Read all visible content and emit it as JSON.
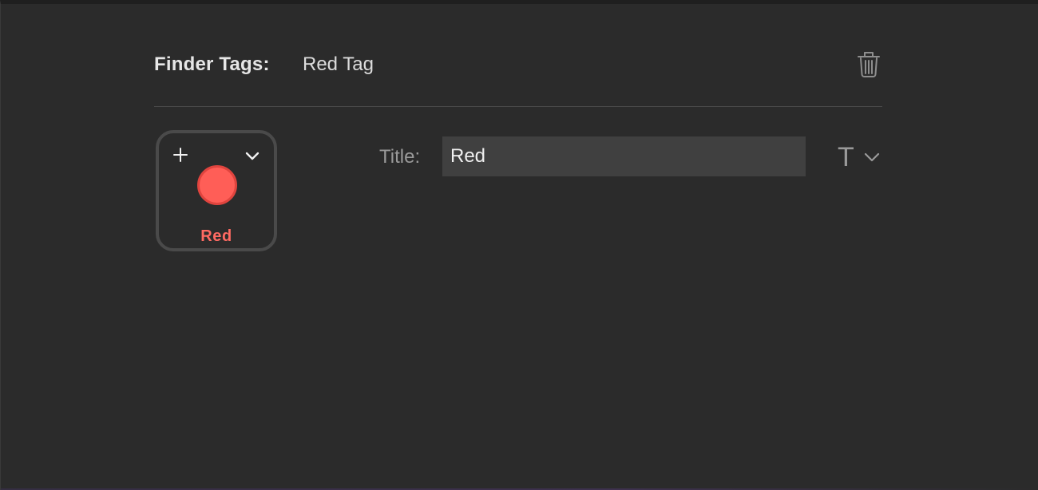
{
  "header": {
    "label": "Finder Tags:",
    "value": "Red Tag",
    "delete_icon": "trash-icon"
  },
  "tag_tile": {
    "caption": "Red",
    "color": "#ff5e57",
    "caption_color": "#ff6a62",
    "add_icon": "plus-icon",
    "menu_icon": "chevron-down-icon"
  },
  "form": {
    "title_label": "Title:",
    "title_value": "Red",
    "font_icon": "text-format-icon",
    "font_glyph": "T",
    "font_menu_icon": "chevron-down-icon"
  }
}
